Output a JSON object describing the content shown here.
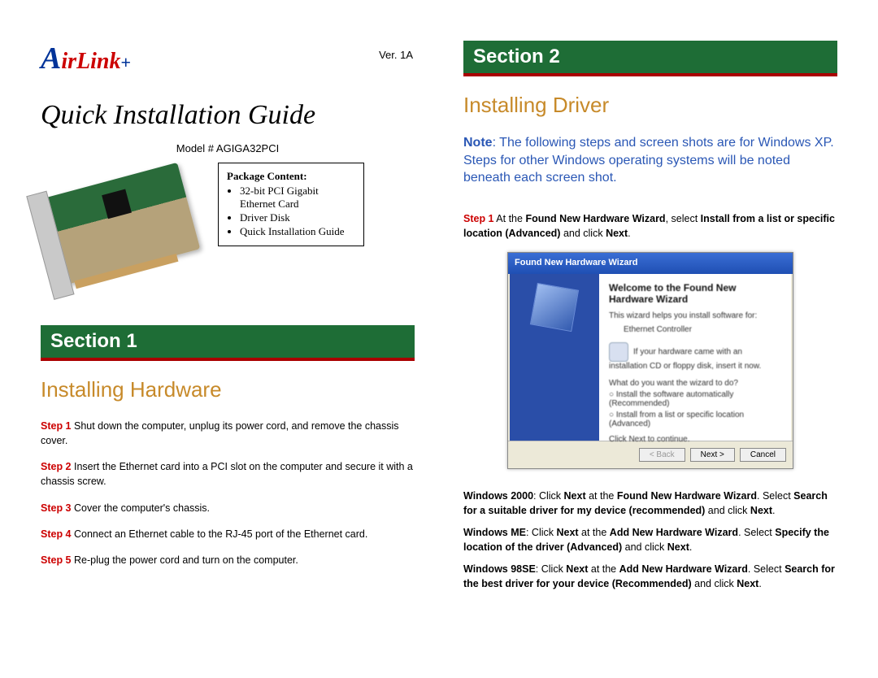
{
  "brand": "AirLink+",
  "version": "Ver. 1A",
  "title": "Quick Installation Guide",
  "model": "Model # AGIGA32PCI",
  "package": {
    "heading": "Package Content:",
    "items": [
      "32-bit PCI Gigabit Ethernet Card",
      "Driver Disk",
      "Quick Installation Guide"
    ]
  },
  "section1": {
    "bar": "Section 1",
    "heading": "Installing Hardware",
    "steps": [
      {
        "label": "Step 1",
        "text": "Shut down the computer, unplug its power cord, and remove the chassis cover."
      },
      {
        "label": "Step 2",
        "text": "Insert the Ethernet card into a PCI slot on the computer and secure it with a chassis screw."
      },
      {
        "label": "Step 3",
        "text": "Cover the computer's chassis."
      },
      {
        "label": "Step 4",
        "text": "Connect an Ethernet cable to the RJ-45 port of the Ethernet card."
      },
      {
        "label": "Step 5",
        "text": "Re-plug the power cord and turn on the computer."
      }
    ]
  },
  "section2": {
    "bar": "Section 2",
    "heading": "Installing Driver",
    "note_label": "Note",
    "note_text": ": The following steps and screen shots are for Windows XP. Steps for other Windows operating systems will be noted beneath each screen shot.",
    "step1_label": "Step 1",
    "step1_pre": " At the ",
    "step1_b1": "Found New Hardware Wizard",
    "step1_mid": ", select ",
    "step1_b2": "Install from a list or specific location (Advanced)",
    "step1_mid2": " and click ",
    "step1_b3": "Next",
    "step1_end": ".",
    "wizard": {
      "title": "Found New Hardware Wizard",
      "welcome": "Welcome to the Found New Hardware Wizard",
      "help": "This wizard helps you install software for:",
      "device": "Ethernet Controller",
      "cd_hint": "If your hardware came with an installation CD or floppy disk, insert it now.",
      "question": "What do you want the wizard to do?",
      "opt1": "Install the software automatically (Recommended)",
      "opt2": "Install from a list or specific location (Advanced)",
      "cont": "Click Next to continue.",
      "back": "< Back",
      "next": "Next >",
      "cancel": "Cancel"
    },
    "os_notes": [
      {
        "os": "Windows 2000",
        "pre": ": Click ",
        "b1": "Next",
        "mid1": " at the ",
        "b2": "Found New Hardware Wizard",
        "mid2": ". Select ",
        "b3": "Search for a suitable driver for my device (recommended)",
        "mid3": " and click ",
        "b4": "Next",
        "end": "."
      },
      {
        "os": "Windows ME",
        "pre": ": Click ",
        "b1": "Next",
        "mid1": " at the ",
        "b2": "Add New Hardware Wizard",
        "mid2": ". Select ",
        "b3": "Specify the location of the driver (Advanced)",
        "mid3": " and click ",
        "b4": "Next",
        "end": "."
      },
      {
        "os": "Windows 98SE",
        "pre": ": Click ",
        "b1": "Next",
        "mid1": " at the ",
        "b2": "Add New Hardware Wizard",
        "mid2": ". Select ",
        "b3": "Search for the best driver for your device (Recommended)",
        "mid3": " and click ",
        "b4": "Next",
        "end": "."
      }
    ]
  }
}
